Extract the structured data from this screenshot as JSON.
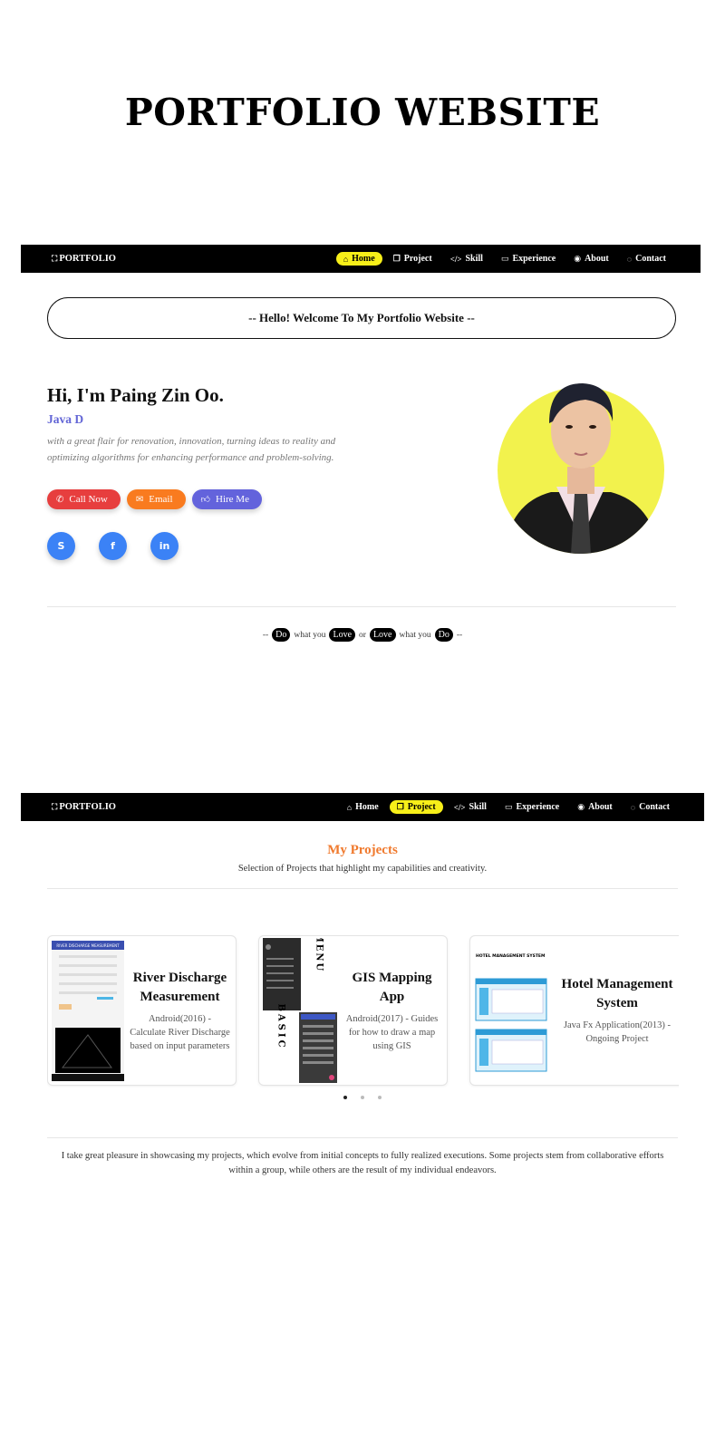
{
  "page": {
    "title": "PORTFOLIO WEBSITE"
  },
  "navbar_home": {
    "brand": "PORTFOLIO",
    "brand_icon": "focus-icon",
    "items": [
      {
        "label": "Home",
        "icon": "home-icon",
        "active": true
      },
      {
        "label": "Project",
        "icon": "copy-icon",
        "active": false
      },
      {
        "label": "Skill",
        "icon": "code-icon",
        "active": false
      },
      {
        "label": "Experience",
        "icon": "briefcase-icon",
        "active": false
      },
      {
        "label": "About",
        "icon": "user-circle-icon",
        "active": false
      },
      {
        "label": "Contact",
        "icon": "chat-icon",
        "active": false
      }
    ]
  },
  "navbar_project": {
    "brand": "PORTFOLIO",
    "items": [
      {
        "label": "Home",
        "active": false
      },
      {
        "label": "Project",
        "active": true
      },
      {
        "label": "Skill",
        "active": false
      },
      {
        "label": "Experience",
        "active": false
      },
      {
        "label": "About",
        "active": false
      },
      {
        "label": "Contact",
        "active": false
      }
    ]
  },
  "welcome": "-- Hello! Welcome To My Portfolio Website --",
  "hero": {
    "name": "Hi, I'm Paing Zin Oo.",
    "role": "Java D",
    "description": "with a great flair for renovation, innovation, turning ideas to reality and optimizing algorithms for enhancing performance and problem-solving.",
    "buttons": [
      {
        "label": "Call Now",
        "icon": "phone-icon",
        "color": "#e73e3e"
      },
      {
        "label": "Email",
        "icon": "mail-icon",
        "color": "#f97b1f"
      },
      {
        "label": "Hire Me",
        "icon": "thumbs-up-icon",
        "color": "#6363dc"
      }
    ],
    "socials": [
      {
        "name": "skype",
        "icon": "skype-icon"
      },
      {
        "name": "facebook",
        "icon": "facebook-icon"
      },
      {
        "name": "linkedin",
        "icon": "linkedin-icon"
      }
    ],
    "avatar_bg": "#f2f24d"
  },
  "motto": {
    "open": "--",
    "w1": "Do",
    "w2": "what you",
    "w3": "Love",
    "w4": "or",
    "w5": "Love",
    "w6": "what you",
    "w7": "Do",
    "close": "--"
  },
  "projects": {
    "title": "My Projects",
    "subtitle": "Selection of Projects that highlight my capabilities and creativity.",
    "cards": [
      {
        "title": "River Discharge Measurement",
        "desc": "Android(2016) - Calculate River Discharge based on input parameters",
        "thumb_caption": "RIVER DISCHARGE MEASUREMENT"
      },
      {
        "title": "GIS Mapping App",
        "desc": "Android(2017) - Guides for how to draw a map using GIS",
        "thumb_menu": "MENU",
        "thumb_basic": "BASIC"
      },
      {
        "title": "Hotel Management System",
        "desc": "Java Fx Application(2013) - Ongoing Project",
        "thumb_caption": "HOTEL MANAGEMENT SYSTEM"
      }
    ],
    "carousel_active": 1,
    "carousel_pages": 3,
    "footer": "I take great pleasure in showcasing my projects, which evolve from initial concepts to fully realized executions. Some projects stem from collaborative efforts within a group, while others are the result of my individual endeavors."
  },
  "colors": {
    "accent_yellow": "#f7ef19",
    "project_title": "#f07a2e",
    "role": "#6366d6",
    "social": "#3b82f6"
  }
}
